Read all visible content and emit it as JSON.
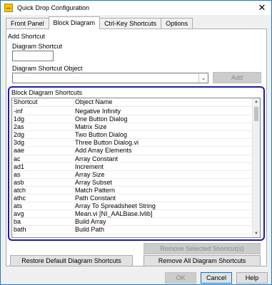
{
  "window": {
    "title": "Quick Drop Configuration",
    "close_glyph": "✕"
  },
  "tabs": [
    {
      "label": "Front Panel",
      "active": false
    },
    {
      "label": "Block Diagram",
      "active": true
    },
    {
      "label": "Ctrl-Key Shortcuts",
      "active": false
    },
    {
      "label": "Options",
      "active": false
    }
  ],
  "add_shortcut": {
    "group_title": "Add Shortcut",
    "diagram_shortcut_label": "Diagram Shortcut",
    "diagram_shortcut_value": "",
    "object_label": "Diagram Shortcut Object",
    "object_value": "",
    "combo_arrow_glyph": "⌄",
    "add_button": "Add"
  },
  "shortcuts": {
    "group_title": "Block Diagram Shortcuts",
    "columns": [
      "Shortcut",
      "Object Name"
    ],
    "rows": [
      [
        "-inf",
        "Negative Infinity"
      ],
      [
        "1dg",
        "One Button Dialog"
      ],
      [
        "2as",
        "Matrix Size"
      ],
      [
        "2dg",
        "Two Button Dialog"
      ],
      [
        "3dg",
        "Three Button Dialog.vi"
      ],
      [
        "aae",
        "Add Array Elements"
      ],
      [
        "ac",
        "Array Constant"
      ],
      [
        "ad1",
        "Increment"
      ],
      [
        "as",
        "Array Size"
      ],
      [
        "asb",
        "Array Subset"
      ],
      [
        "atch",
        "Match Pattern"
      ],
      [
        "athc",
        "Path Constant"
      ],
      [
        "ats",
        "Array To Spreadsheet String"
      ],
      [
        "avg",
        "Mean.vi [NI_AALBase.lvlib]"
      ],
      [
        "ba",
        "Build Array"
      ],
      [
        "bath",
        "Build Path"
      ]
    ],
    "scroll_up_glyph": "▲",
    "scroll_down_glyph": "▼"
  },
  "buttons": {
    "remove_selected": "Remove Selected Shortcut(s)",
    "restore_default": "Restore Default Diagram Shortcuts",
    "remove_all": "Remove All Diagram Shortcuts",
    "ok": "OK",
    "cancel": "Cancel",
    "help": "Help"
  },
  "colors": {
    "highlight_border": "#1a1ab8",
    "window_border": "#1979ca",
    "default_button_border": "#0078d7"
  }
}
